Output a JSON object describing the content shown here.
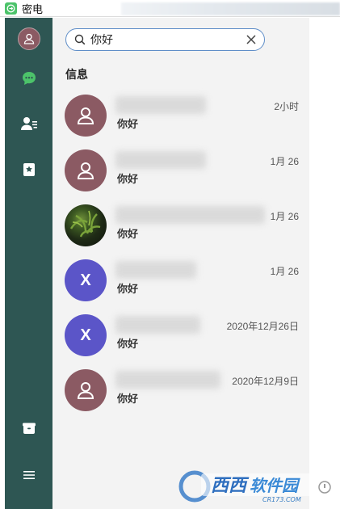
{
  "app": {
    "title": "密电"
  },
  "sidebar": {
    "items": [
      {
        "icon": "user-avatar-icon"
      },
      {
        "icon": "chat-bubble-icon",
        "active": true
      },
      {
        "icon": "contacts-icon"
      },
      {
        "icon": "bookmark-icon"
      },
      {
        "icon": "package-icon"
      },
      {
        "icon": "menu-icon"
      }
    ]
  },
  "search": {
    "value": "你好",
    "icon": "search-icon",
    "clear_icon": "close-icon"
  },
  "messages": {
    "section_title": "信息",
    "conversations": [
      {
        "avatar": "user",
        "time": "2小时",
        "preview": "你好"
      },
      {
        "avatar": "user",
        "time": "1月 26",
        "preview": "你好"
      },
      {
        "avatar": "image",
        "time": "1月 26",
        "preview": "你好"
      },
      {
        "avatar": "letter",
        "letter": "X",
        "time": "1月 26",
        "preview": "你好"
      },
      {
        "avatar": "letter",
        "letter": "X",
        "time": "2020年12月26日",
        "preview": "你好"
      },
      {
        "avatar": "user",
        "time": "2020年12月9日",
        "preview": "你好"
      }
    ]
  },
  "watermark": {
    "text": "西西软件园",
    "subtext": "CR173.COM"
  },
  "colors": {
    "sidebar": "#2e5653",
    "active_icon": "#4cc36a",
    "avatar_user": "#8b5a63",
    "avatar_letter": "#5b55c8",
    "search_border": "#5f8ec8",
    "panel": "#f3f3f3"
  }
}
